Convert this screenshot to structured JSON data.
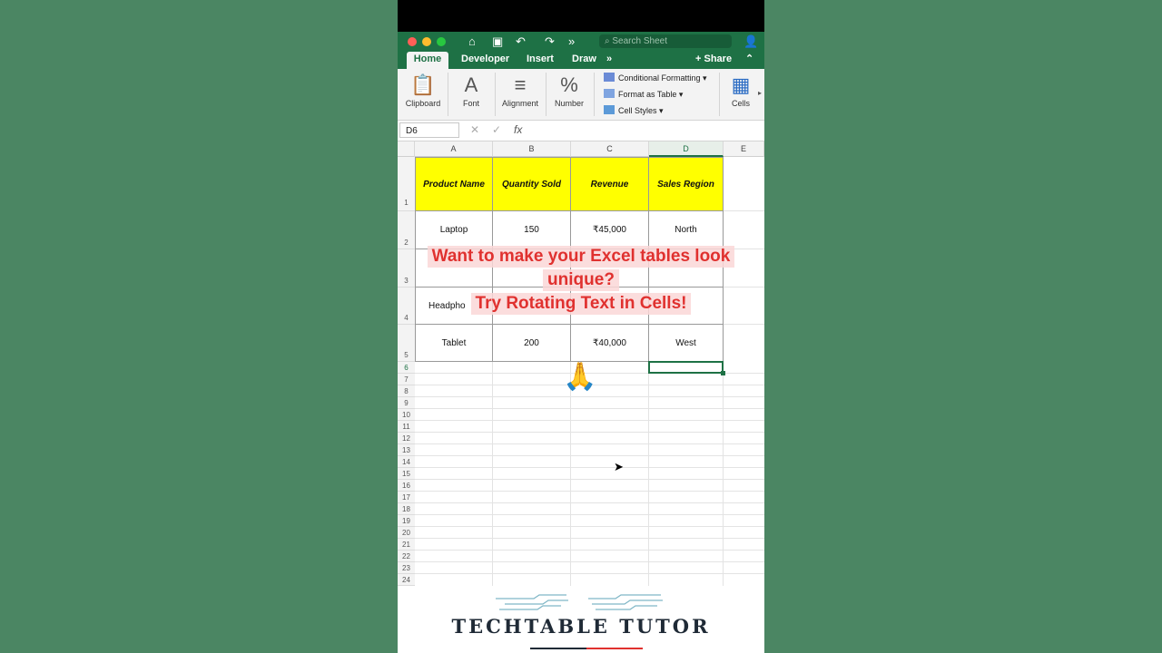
{
  "window": {
    "search_placeholder": "Search Sheet",
    "share_label": "Share"
  },
  "tabs": [
    {
      "label": "Home"
    },
    {
      "label": "Developer"
    },
    {
      "label": "Insert"
    },
    {
      "label": "Draw"
    }
  ],
  "ribbon": {
    "clipboard": "Clipboard",
    "font": "Font",
    "alignment": "Alignment",
    "number": "Number",
    "number_glyph": "%",
    "conditional_formatting": "Conditional Formatting",
    "format_as_table": "Format as Table",
    "cell_styles": "Cell Styles",
    "cells": "Cells"
  },
  "formula_bar": {
    "name_box": "D6",
    "fx": "fx"
  },
  "columns": [
    "A",
    "B",
    "C",
    "D",
    "E"
  ],
  "rows": [
    "1",
    "2",
    "3",
    "4",
    "5",
    "6",
    "7",
    "8",
    "9",
    "10",
    "11",
    "12",
    "13",
    "14",
    "15",
    "16",
    "17",
    "18",
    "19",
    "20",
    "21",
    "22",
    "23",
    "24"
  ],
  "table": {
    "headers": [
      "Product Name",
      "Quantity Sold",
      "Revenue",
      "Sales Region"
    ],
    "rows": [
      [
        "Laptop",
        "150",
        "₹45,000",
        "North"
      ],
      [
        "",
        "",
        "",
        ""
      ],
      [
        "Headpho",
        "",
        "",
        ""
      ],
      [
        "Tablet",
        "200",
        "₹40,000",
        "West"
      ]
    ]
  },
  "overlay": {
    "line1": "Want to make your Excel tables look",
    "line2": "unique?",
    "line3": "Try Rotating Text in Cells!",
    "emoji": "🙏"
  },
  "brand": {
    "name": "TECHTABLE TUTOR"
  },
  "colors": {
    "excel_green": "#1e7145",
    "header_fill": "#ffff00",
    "overlay_text": "#e0312f"
  }
}
